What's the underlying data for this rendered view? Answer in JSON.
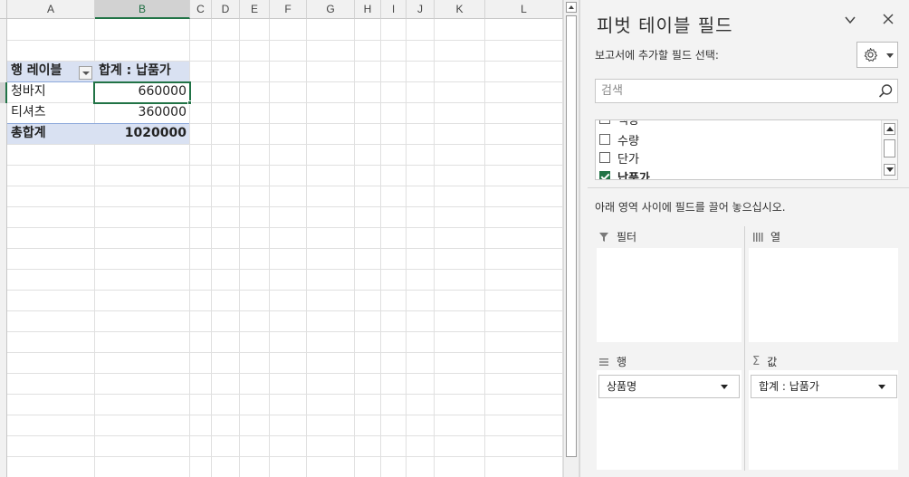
{
  "sheet": {
    "columns": [
      "A",
      "B",
      "C",
      "D",
      "E",
      "F",
      "G",
      "H",
      "I",
      "J",
      "K",
      "L"
    ],
    "selected_column": "B",
    "pivot": {
      "row_label_header": "행 레이블",
      "value_header": "합계 : 납품가",
      "rows": [
        {
          "label": "청바지",
          "value": "660000"
        },
        {
          "label": "티셔츠",
          "value": "360000"
        }
      ],
      "total_label": "총합계",
      "total_value": "1020000"
    }
  },
  "pane": {
    "title": "피벗 테이블 필드",
    "subtitle": "보고서에 추가할 필드 선택:",
    "search_placeholder": "검색",
    "fields": [
      {
        "label": "색상",
        "checked": false
      },
      {
        "label": "수량",
        "checked": false
      },
      {
        "label": "단가",
        "checked": false
      },
      {
        "label": "납품가",
        "checked": true
      }
    ],
    "hint": "아래 영역 사이에 필드를 끌어 놓으십시오.",
    "areas": {
      "filter": {
        "label": "필터",
        "icon": "filter-icon"
      },
      "columns": {
        "label": "열",
        "icon": "columns-icon"
      },
      "rows": {
        "label": "행",
        "icon": "rows-icon",
        "chip": "상품명"
      },
      "values": {
        "label": "값",
        "icon": "sigma-icon",
        "chip": "합계 : 납품가"
      }
    }
  },
  "colors": {
    "accent": "#217346",
    "pivot_band": "#d9e1f2",
    "pivot_line": "#8ea9db",
    "pane_bg": "#f3f3f3"
  }
}
